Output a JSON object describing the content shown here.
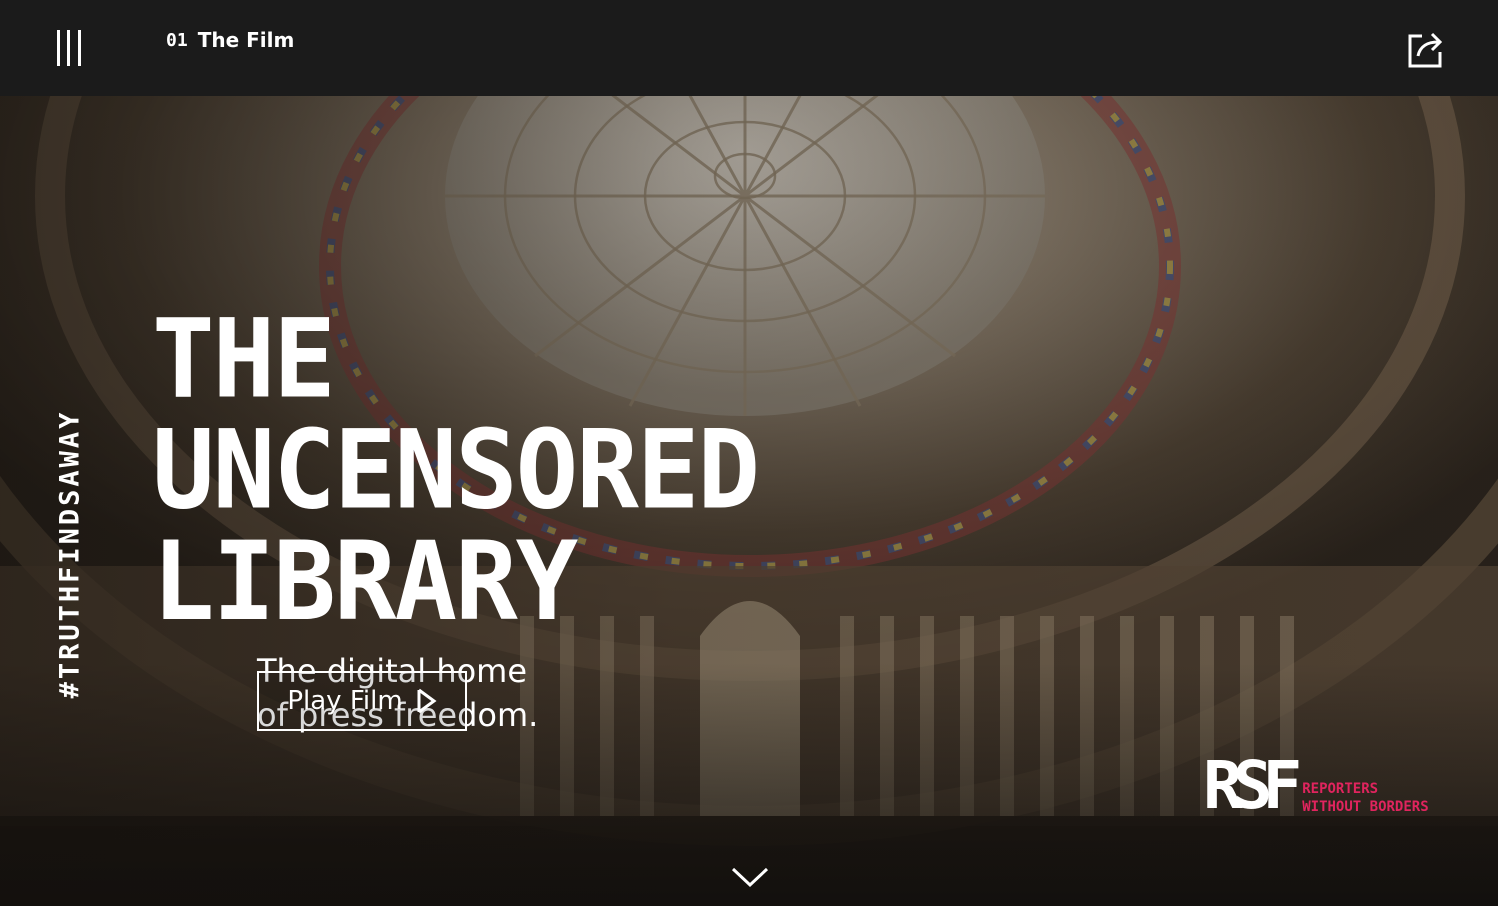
{
  "header": {
    "chapter_number": "01",
    "chapter_title": "The Film",
    "menu_icon": "menu-icon",
    "share_icon": "share-icon"
  },
  "hero": {
    "hashtag": "#TRUTHFINDSAWAY",
    "title_lines": [
      "THE",
      "UNCENSORED",
      "LIBRARY"
    ],
    "subtitle_line1": "The digital home",
    "subtitle_line2": "of press freedom.",
    "play_button_label": "Play Film",
    "play_icon": "play-icon",
    "scroll_icon": "chevron-down-icon"
  },
  "logo": {
    "mark": "RSF",
    "name_line1": "REPORTERS",
    "name_line2": "WITHOUT BORDERS",
    "accent_color": "#e0245e"
  },
  "colors": {
    "topbar": "#1b1b1b",
    "text": "#ffffff"
  }
}
